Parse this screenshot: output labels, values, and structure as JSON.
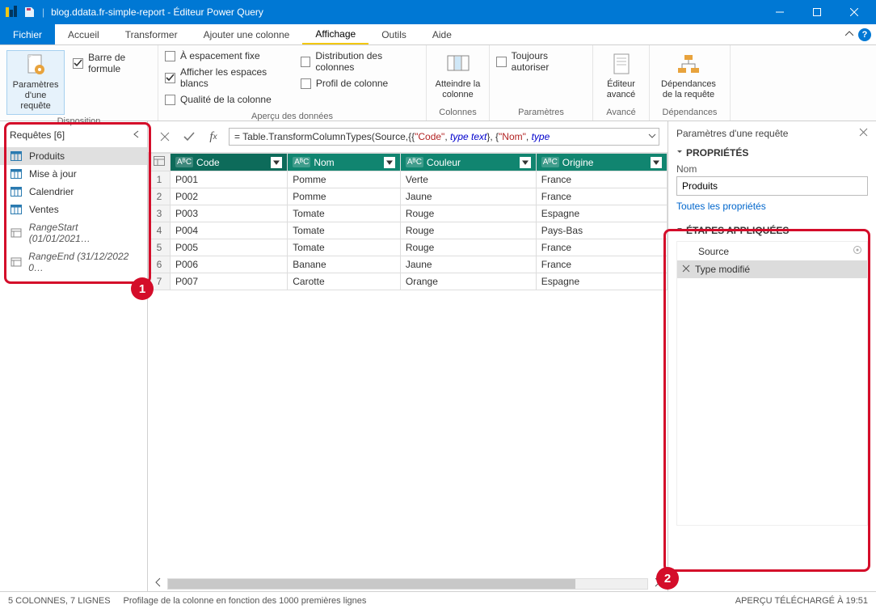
{
  "titlebar": {
    "doc_title": "blog.ddata.fr-simple-report",
    "app_title": "Éditeur Power Query"
  },
  "tabs": {
    "file": "Fichier",
    "home": "Accueil",
    "transform": "Transformer",
    "addcol": "Ajouter une colonne",
    "view": "Affichage",
    "tools": "Outils",
    "help": "Aide"
  },
  "ribbon": {
    "layout_group": "Disposition",
    "preview_group": "Aperçu des données",
    "columns_group": "Colonnes",
    "params_group": "Paramètres",
    "advanced_group": "Avancé",
    "deps_group": "Dépendances",
    "query_settings_btn": "Paramètres d'une requête",
    "formula_bar": "Barre de formule",
    "monospaced": "À espacement fixe",
    "show_whitespace": "Afficher les espaces blancs",
    "column_quality": "Qualité de la colonne",
    "column_distribution": "Distribution des colonnes",
    "column_profile": "Profil de colonne",
    "goto_column": "Atteindre la colonne",
    "always_allow": "Toujours autoriser",
    "advanced_editor": "Éditeur avancé",
    "query_deps": "Dépendances de la requête"
  },
  "queries": {
    "header": "Requêtes [6]",
    "items": [
      {
        "label": "Produits",
        "type": "table",
        "selected": true
      },
      {
        "label": "Mise à jour",
        "type": "table"
      },
      {
        "label": "Calendrier",
        "type": "table"
      },
      {
        "label": "Ventes",
        "type": "table"
      },
      {
        "label": "RangeStart (01/01/2021…",
        "type": "param"
      },
      {
        "label": "RangeEnd (31/12/2022 0…",
        "type": "param"
      }
    ]
  },
  "formula": {
    "prefix": "= Table.TransformColumnTypes(Source,{{",
    "s1": "\"Code\"",
    "mid1": ", ",
    "kw1": "type text",
    "mid2": "}, {",
    "s2": "\"Nom\"",
    "mid3": ", ",
    "kw2": "type"
  },
  "grid": {
    "columns": [
      "Code",
      "Nom",
      "Couleur",
      "Origine"
    ],
    "type_label": "AᴮC",
    "rows": [
      [
        "P001",
        "Pomme",
        "Verte",
        "France"
      ],
      [
        "P002",
        "Pomme",
        "Jaune",
        "France"
      ],
      [
        "P003",
        "Tomate",
        "Rouge",
        "Espagne"
      ],
      [
        "P004",
        "Tomate",
        "Rouge",
        "Pays-Bas"
      ],
      [
        "P005",
        "Tomate",
        "Rouge",
        "France"
      ],
      [
        "P006",
        "Banane",
        "Jaune",
        "France"
      ],
      [
        "P007",
        "Carotte",
        "Orange",
        "Espagne"
      ]
    ]
  },
  "rightpane": {
    "title": "Paramètres d'une requête",
    "properties_title": "PROPRIÉTÉS",
    "name_label": "Nom",
    "name_value": "Produits",
    "all_props": "Toutes les propriétés",
    "steps_title": "ÉTAPES APPLIQUÉES",
    "steps": [
      {
        "label": "Source",
        "gear": true
      },
      {
        "label": "Type modifié",
        "selected": true
      }
    ]
  },
  "statusbar": {
    "left1": "5 COLONNES, 7 LIGNES",
    "left2": "Profilage de la colonne en fonction des 1000 premières lignes",
    "right": "APERÇU TÉLÉCHARGÉ À 19:51"
  },
  "annotations": {
    "one": "1",
    "two": "2"
  }
}
